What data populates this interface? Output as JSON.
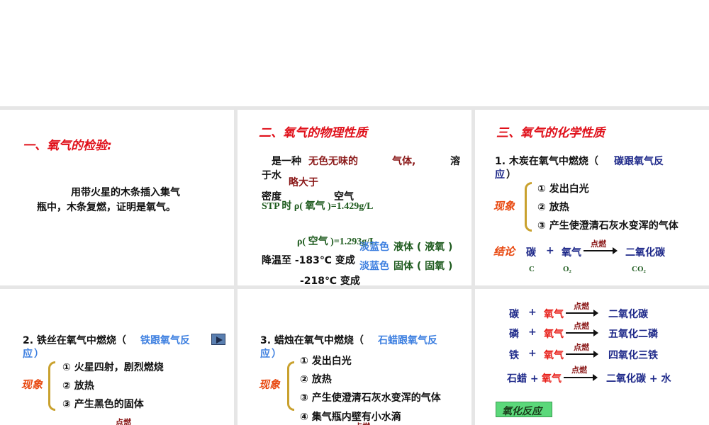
{
  "p1": {
    "title": "一、氧气的检验:",
    "body1": "用带火星的木条插入集气",
    "body2": "瓶中，木条复燃，证明是氧气。"
  },
  "p2": {
    "title": "二、氧气的物理性质",
    "l1a": "是一种",
    "l1b": "无色无味的",
    "l1c": "气体,",
    "l1d": "溶",
    "l2": "于水",
    "l2b": "略大于",
    "l3a": "密度",
    "l3b": "空气",
    "stp": "STP 时  ρ( 氧气 )=1.429g/L",
    "air": "ρ( 空气 )=1.293g/L",
    "cool1": "降温至 -183℃ 变成",
    "cool2": "-218℃ 变成",
    "lb1": "淡蓝色",
    "liq": "液体 ( 液氧 )",
    "lb2": "淡蓝色",
    "sol": "固体 ( 固氧 )"
  },
  "p3": {
    "title": "三、氧气的化学性质",
    "h1": "1. 木炭在氧气中燃烧（",
    "h2": "碳跟氧气反",
    "h3": "应",
    "h4": "）",
    "label": "现象",
    "items": [
      "① 发出白光",
      "② 放热",
      "③ 产生使澄清石灰水变浑的气体"
    ],
    "concl": "结论",
    "c": "碳",
    "plus": "+",
    "o": "氧气",
    "ignite": "点燃",
    "prod": "二氧化碳",
    "f1": "C",
    "f2": "O₂",
    "f3": "CO₂"
  },
  "p4": {
    "h1": "2. 铁丝在氧气中燃烧（",
    "h2": "铁跟氧气反",
    "h3": "应",
    "h4": "）",
    "label": "现象",
    "items": [
      "① 火星四射，剧烈燃烧",
      "② 放热",
      "③ 产生黑色的固体"
    ],
    "ignite": "点燃"
  },
  "p5": {
    "h1": "3. 蜡烛在氧气中燃烧（",
    "h2": "石蜡跟氧气反",
    "h3": "应",
    "h4": "）",
    "label": "现象",
    "items": [
      "① 发出白光",
      "② 放热",
      "③ 产生使澄清石灰水变浑的气体",
      "④ 集气瓶内壁有小水滴"
    ],
    "ignite": "点燃"
  },
  "p6": {
    "rows": [
      {
        "a": "碳",
        "plus": "+",
        "o": "氧气",
        "ignite": "点燃",
        "p": "二氧化碳"
      },
      {
        "a": "磷",
        "plus": "+",
        "o": "氧气",
        "ignite": "点燃",
        "p": "五氧化二磷"
      },
      {
        "a": "铁",
        "plus": "+",
        "o": "氧气",
        "ignite": "点燃",
        "p": "四氧化三铁"
      },
      {
        "a": "石蜡 +",
        "plus": "",
        "o": "氧气",
        "ignite": "点燃",
        "p": "二氧化碳 + 水"
      }
    ],
    "badge": "氧化反应"
  }
}
